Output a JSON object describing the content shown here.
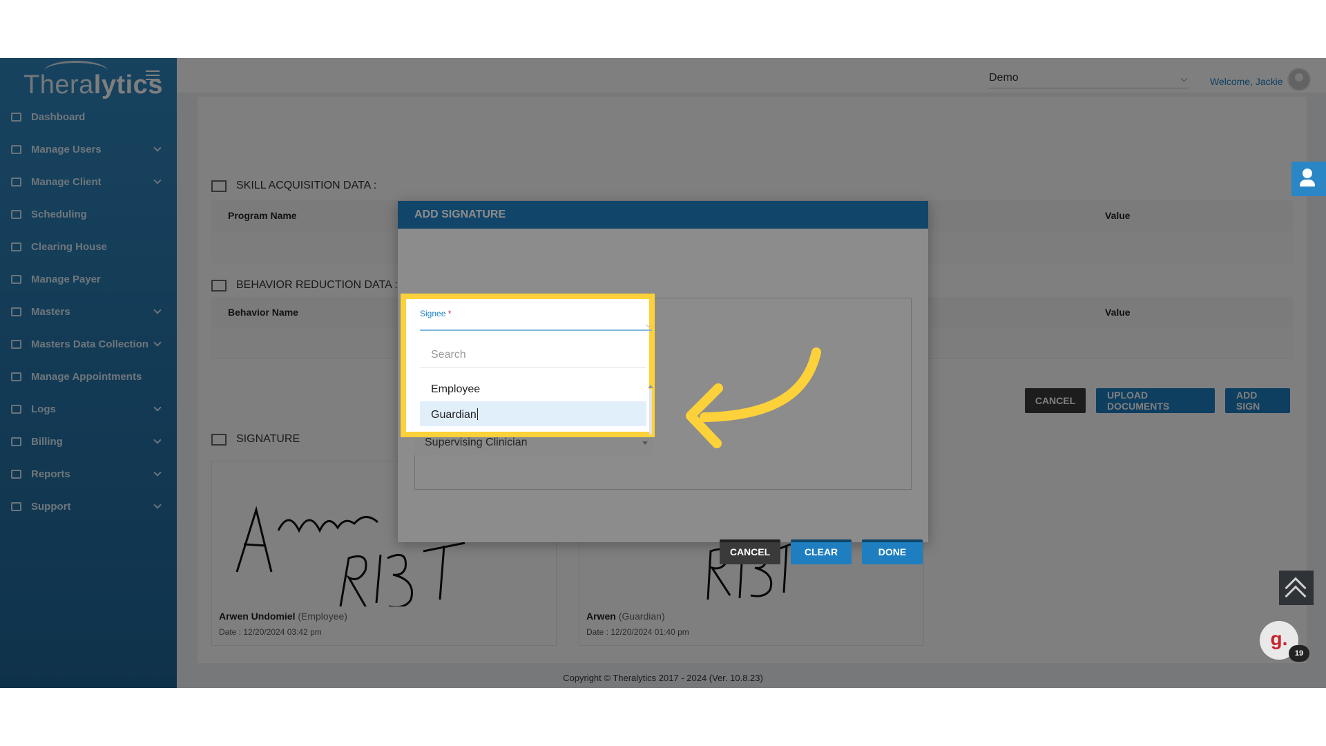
{
  "app": {
    "logo_prefix": "Thera",
    "logo_suffix": "lytics",
    "company": "Demo",
    "welcome": "Welcome, Jackie"
  },
  "sidebar": {
    "items": [
      {
        "label": "Dashboard",
        "has_children": false
      },
      {
        "label": "Manage Users",
        "has_children": true
      },
      {
        "label": "Manage Client",
        "has_children": true
      },
      {
        "label": "Scheduling",
        "has_children": false
      },
      {
        "label": "Clearing House",
        "has_children": false
      },
      {
        "label": "Manage Payer",
        "has_children": false
      },
      {
        "label": "Masters",
        "has_children": true
      },
      {
        "label": "Masters Data Collection",
        "has_children": true
      },
      {
        "label": "Manage Appointments",
        "has_children": false
      },
      {
        "label": "Logs",
        "has_children": true
      },
      {
        "label": "Billing",
        "has_children": true
      },
      {
        "label": "Reports",
        "has_children": true
      },
      {
        "label": "Support",
        "has_children": true
      }
    ]
  },
  "main": {
    "skill_title": "SKILL ACQUISITION DATA :",
    "skill_columns": {
      "program": "Program Name",
      "value": "Value"
    },
    "behavior_title": "BEHAVIOR REDUCTION DATA :",
    "behavior_columns": {
      "name": "Behavior Name",
      "value": "Value"
    },
    "buttons": {
      "cancel": "CANCEL",
      "upload": "UPLOAD DOCUMENTS",
      "add_sign": "ADD SIGN"
    },
    "signature_title": "SIGNATURE",
    "signatures": [
      {
        "name": "Arwen Undomiel",
        "role": "(Employee)",
        "date": "Date : 12/20/2024 03:42 pm"
      },
      {
        "name": "Arwen",
        "role": "(Guardian)",
        "date": "Date : 12/20/2024 01:40 pm"
      }
    ],
    "copyright": "Copyright © Theralytics 2017 - 2024 (Ver. 10.8.23)"
  },
  "widgets": {
    "notification_count": "19",
    "badge_letter": "g."
  },
  "modal": {
    "title": "ADD SIGNATURE",
    "signee_label": "Signee",
    "required_mark": "*",
    "search_placeholder": "Search",
    "options": [
      "Employee",
      "Guardian",
      "Supervising Clinician"
    ],
    "selected_option": "Guardian",
    "buttons": {
      "cancel": "CANCEL",
      "clear": "CLEAR",
      "done": "DONE"
    }
  },
  "colors": {
    "sidebar": "#2877ad",
    "primary_button": "#1f7ec0",
    "dark_button": "#3a3a3a",
    "highlight": "#fcd13a"
  }
}
